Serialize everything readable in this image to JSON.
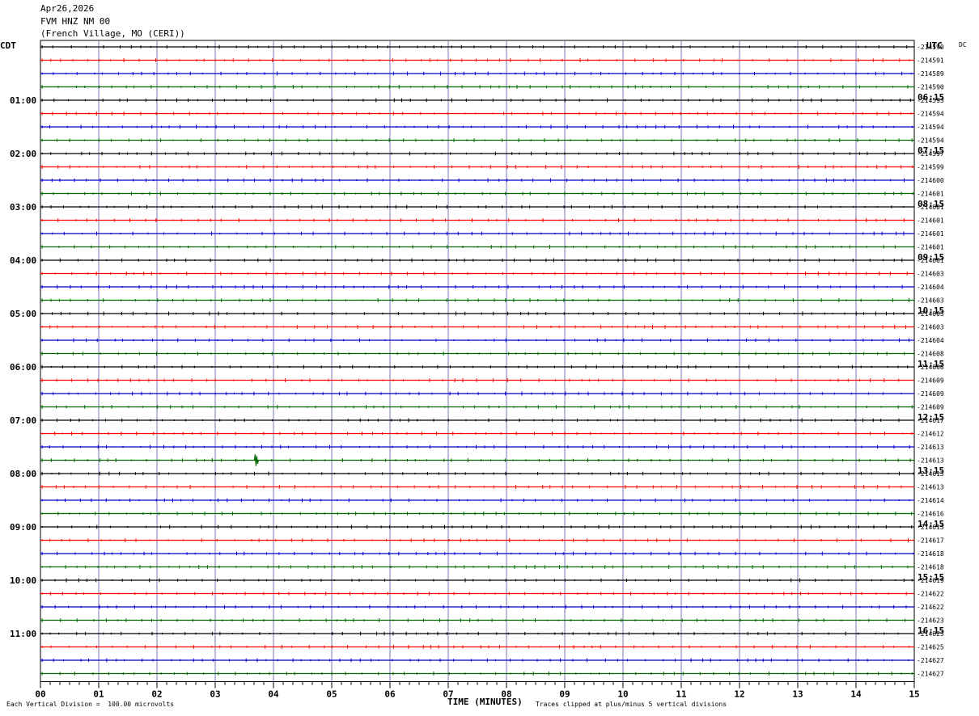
{
  "header": {
    "date": "Apr26,2026",
    "station": "FVM HNZ NM 00",
    "location": "(French Village, MO (CERI))"
  },
  "labels": {
    "left_tz": "CDT",
    "right_tz": "UTC",
    "dc": "DC",
    "x_title": "TIME (MINUTES)",
    "footer_left": "Each Vertical Division =  100.00 microvolts",
    "footer_right": "Traces clipped at plus/minus 5 vertical divisions"
  },
  "colors": {
    "c0": "#000000",
    "c1": "#ff0000",
    "c2": "#0000cc",
    "c3": "#006600",
    "grid": "#7777bb"
  },
  "chart_data": {
    "type": "line",
    "x_ticks": [
      "00",
      "01",
      "02",
      "03",
      "04",
      "05",
      "06",
      "07",
      "08",
      "09",
      "10",
      "11",
      "12",
      "13",
      "14",
      "15"
    ],
    "xlim": [
      0,
      15
    ],
    "left_hour_labels": [
      "01:00",
      "02:00",
      "03:00",
      "04:00",
      "05:00",
      "06:00",
      "07:00",
      "08:00",
      "09:00",
      "10:00",
      "11:00"
    ],
    "right_hour_labels": [
      "06:15",
      "07:15",
      "08:15",
      "09:15",
      "10:15",
      "11:15",
      "12:15",
      "13:15",
      "14:15",
      "15:15",
      "16:15"
    ],
    "dc_values": [
      "-214590",
      "-214591",
      "-214589",
      "-214590",
      "-214593",
      "-214594",
      "-214594",
      "-214594",
      "-214597",
      "-214599",
      "-214600",
      "-214601",
      "-214601",
      "-214601",
      "-214601",
      "-214601",
      "-214601",
      "-214603",
      "-214604",
      "-214603",
      "-214603",
      "-214603",
      "-214604",
      "-214608",
      "-214608",
      "-214609",
      "-214609",
      "-214609",
      "-214617",
      "-214612",
      "-214613",
      "-214613",
      "-214613",
      "-214613",
      "-214614",
      "-214616",
      "-214615",
      "-214617",
      "-214618",
      "-214618",
      "-214619",
      "-214622",
      "-214622",
      "-214623",
      "-214623",
      "-214625",
      "-214627",
      "-214627"
    ],
    "events": [
      {
        "trace": 31,
        "minute": 3.7,
        "amplitude_div": 1.2
      }
    ]
  }
}
